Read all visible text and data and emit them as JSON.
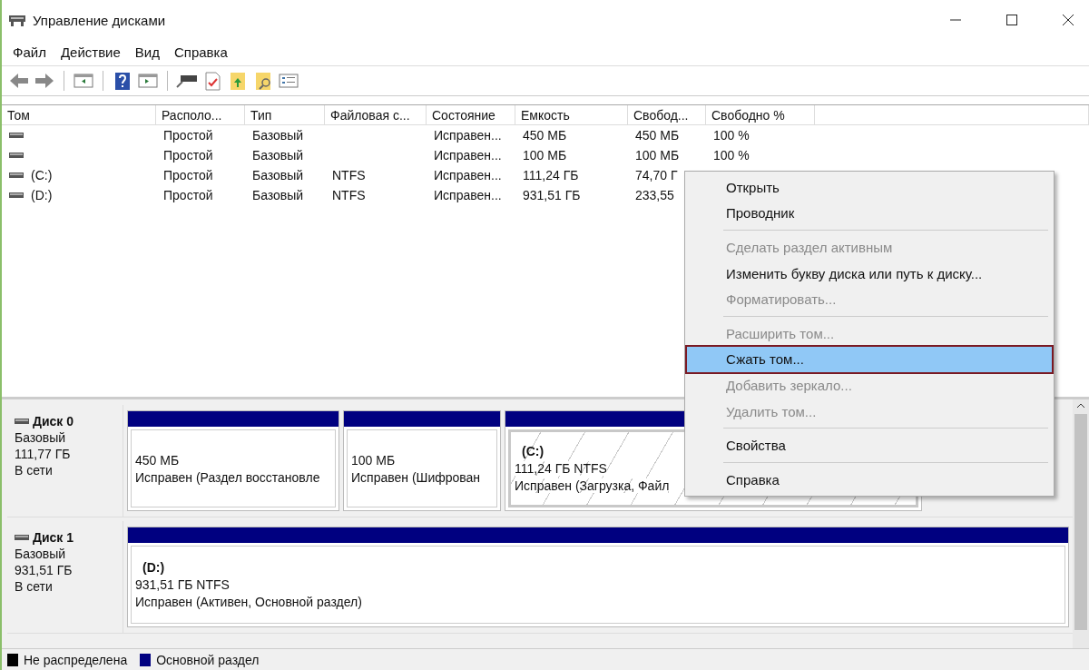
{
  "window": {
    "title": "Управление дисками"
  },
  "menu_bar": [
    "Файл",
    "Действие",
    "Вид",
    "Справка"
  ],
  "table": {
    "columns": [
      "Том",
      "Располо...",
      "Тип",
      "Файловая с...",
      "Состояние",
      "Емкость",
      "Свобод...",
      "Свободно %"
    ],
    "rows": [
      [
        "",
        "Простой",
        "Базовый",
        "",
        "Исправен...",
        "450 МБ",
        "450 МБ",
        "100 %"
      ],
      [
        "",
        "Простой",
        "Базовый",
        "",
        "Исправен...",
        "100 МБ",
        "100 МБ",
        "100 %"
      ],
      [
        "(C:)",
        "Простой",
        "Базовый",
        "NTFS",
        "Исправен...",
        "111,24 ГБ",
        "74,70 Г",
        ""
      ],
      [
        "(D:)",
        "Простой",
        "Базовый",
        "NTFS",
        "Исправен...",
        "931,51 ГБ",
        "233,55",
        ""
      ]
    ]
  },
  "disks": [
    {
      "name": "Диск 0",
      "type": "Базовый",
      "size": "111,77 ГБ",
      "status": "В сети",
      "partitions": [
        {
          "size": "450 МБ",
          "status": "Исправен (Раздел восстановле",
          "selected": false
        },
        {
          "size": "100 МБ",
          "status": "Исправен (Шифрован",
          "selected": false
        },
        {
          "label": "(C:)",
          "size": "111,24 ГБ NTFS",
          "status": "Исправен (Загрузка, Файл",
          "selected": true
        }
      ]
    },
    {
      "name": "Диск 1",
      "type": "Базовый",
      "size": "931,51 ГБ",
      "status": "В сети",
      "partitions": [
        {
          "label": "(D:)",
          "size": "931,51 ГБ NTFS",
          "status": "Исправен (Активен, Основной раздел)",
          "selected": false
        }
      ]
    }
  ],
  "legend": [
    {
      "label": "Не распределена",
      "color": "#000000"
    },
    {
      "label": "Основной раздел",
      "color": "#000080"
    }
  ],
  "context_menu": [
    {
      "kind": "item",
      "label": "Открыть",
      "disabled": false,
      "selected": false
    },
    {
      "kind": "item",
      "label": "Проводник",
      "disabled": false,
      "selected": false
    },
    {
      "kind": "separator"
    },
    {
      "kind": "item",
      "label": "Сделать раздел активным",
      "disabled": true,
      "selected": false
    },
    {
      "kind": "item",
      "label": "Изменить букву диска или путь к диску...",
      "disabled": false,
      "selected": false
    },
    {
      "kind": "item",
      "label": "Форматировать...",
      "disabled": true,
      "selected": false
    },
    {
      "kind": "separator"
    },
    {
      "kind": "item",
      "label": "Расширить том...",
      "disabled": true,
      "selected": false
    },
    {
      "kind": "item",
      "label": "Сжать том...",
      "disabled": false,
      "selected": true
    },
    {
      "kind": "item",
      "label": "Добавить зеркало...",
      "disabled": true,
      "selected": false
    },
    {
      "kind": "item",
      "label": "Удалить том...",
      "disabled": true,
      "selected": false
    },
    {
      "kind": "separator"
    },
    {
      "kind": "item",
      "label": "Свойства",
      "disabled": false,
      "selected": false
    },
    {
      "kind": "separator"
    },
    {
      "kind": "item",
      "label": "Справка",
      "disabled": false,
      "selected": false
    }
  ]
}
